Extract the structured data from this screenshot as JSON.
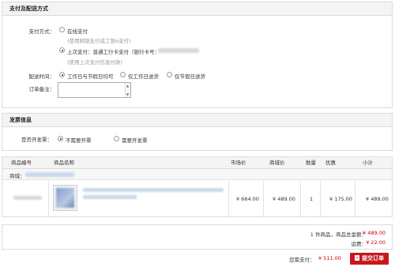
{
  "payment_section": {
    "title": "支付及配送方式",
    "payment_label": "支付方式：",
    "online_pay": "在线支付",
    "online_pay_hint": "(使用网银支付或工银e支付)",
    "last_pay": "上次支付：普通工行卡支付（银行卡号：",
    "last_pay_hint": "(使用上次支付信息付款)",
    "delivery_label": "配送时间：",
    "delivery_options": [
      "工作日与节假日均可",
      "仅工作日送货",
      "仅节假日送货"
    ],
    "remark_label": "订单备注："
  },
  "invoice_section": {
    "title": "发票信息",
    "need_invoice_label": "是否开发票：",
    "options": [
      "不需要开票",
      "需要开发票"
    ]
  },
  "product_table": {
    "headers": [
      "商品编号",
      "商品名称",
      "市场价",
      "商城价",
      "数量",
      "优惠",
      "小计"
    ],
    "shop_label": "商城：",
    "rows": [
      {
        "market_price": "¥ 664.00",
        "mall_price": "¥ 489.00",
        "qty": "1",
        "discount": "¥ 175.00",
        "subtotal": "¥ 489.00"
      }
    ]
  },
  "summary": {
    "items_total_label": "1 件商品，商品总金额：",
    "items_total": "¥ 489.00",
    "shipping_label": "运费：",
    "shipping": "¥ 22.00",
    "payable_label": "您需支付：",
    "payable": "¥ 511.00",
    "submit_label": "提交订单"
  },
  "colors": {
    "accent": "#c8161d",
    "price_red": "#cc0000",
    "link_blue": "#3b6fb6"
  }
}
